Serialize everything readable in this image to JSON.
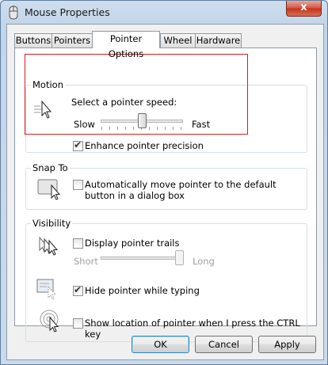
{
  "window": {
    "title": "Mouse Properties",
    "close_label": "x"
  },
  "tabs": [
    {
      "label": "Buttons"
    },
    {
      "label": "Pointers"
    },
    {
      "label": "Pointer Options"
    },
    {
      "label": "Wheel"
    },
    {
      "label": "Hardware"
    }
  ],
  "active_tab": "Pointer Options",
  "motion": {
    "group_label": "Motion",
    "speed_label": "Select a pointer speed:",
    "slow_label": "Slow",
    "fast_label": "Fast",
    "speed_level": 0.5,
    "precision_label": "Enhance pointer precision",
    "precision_checked": true
  },
  "snap_to": {
    "group_label": "Snap To",
    "label": "Automatically move pointer to the default button in a dialog box",
    "checked": false
  },
  "visibility": {
    "group_label": "Visibility",
    "trails_label": "Display pointer trails",
    "trails_checked": false,
    "short_label": "Short",
    "long_label": "Long",
    "trail_level": 1.0,
    "hide_label": "Hide pointer while typing",
    "hide_checked": true,
    "show_location_label": "Show location of pointer when I press the CTRL key",
    "show_location_checked": false
  },
  "buttons": {
    "ok": "OK",
    "cancel": "Cancel",
    "apply": "Apply"
  },
  "icons": {
    "title": "mouse-icon",
    "motion": "pointer-speed-icon",
    "snap": "snap-to-button-icon",
    "trails": "pointer-trails-icon",
    "hide": "hide-pointer-icon",
    "location": "pointer-location-icon"
  }
}
